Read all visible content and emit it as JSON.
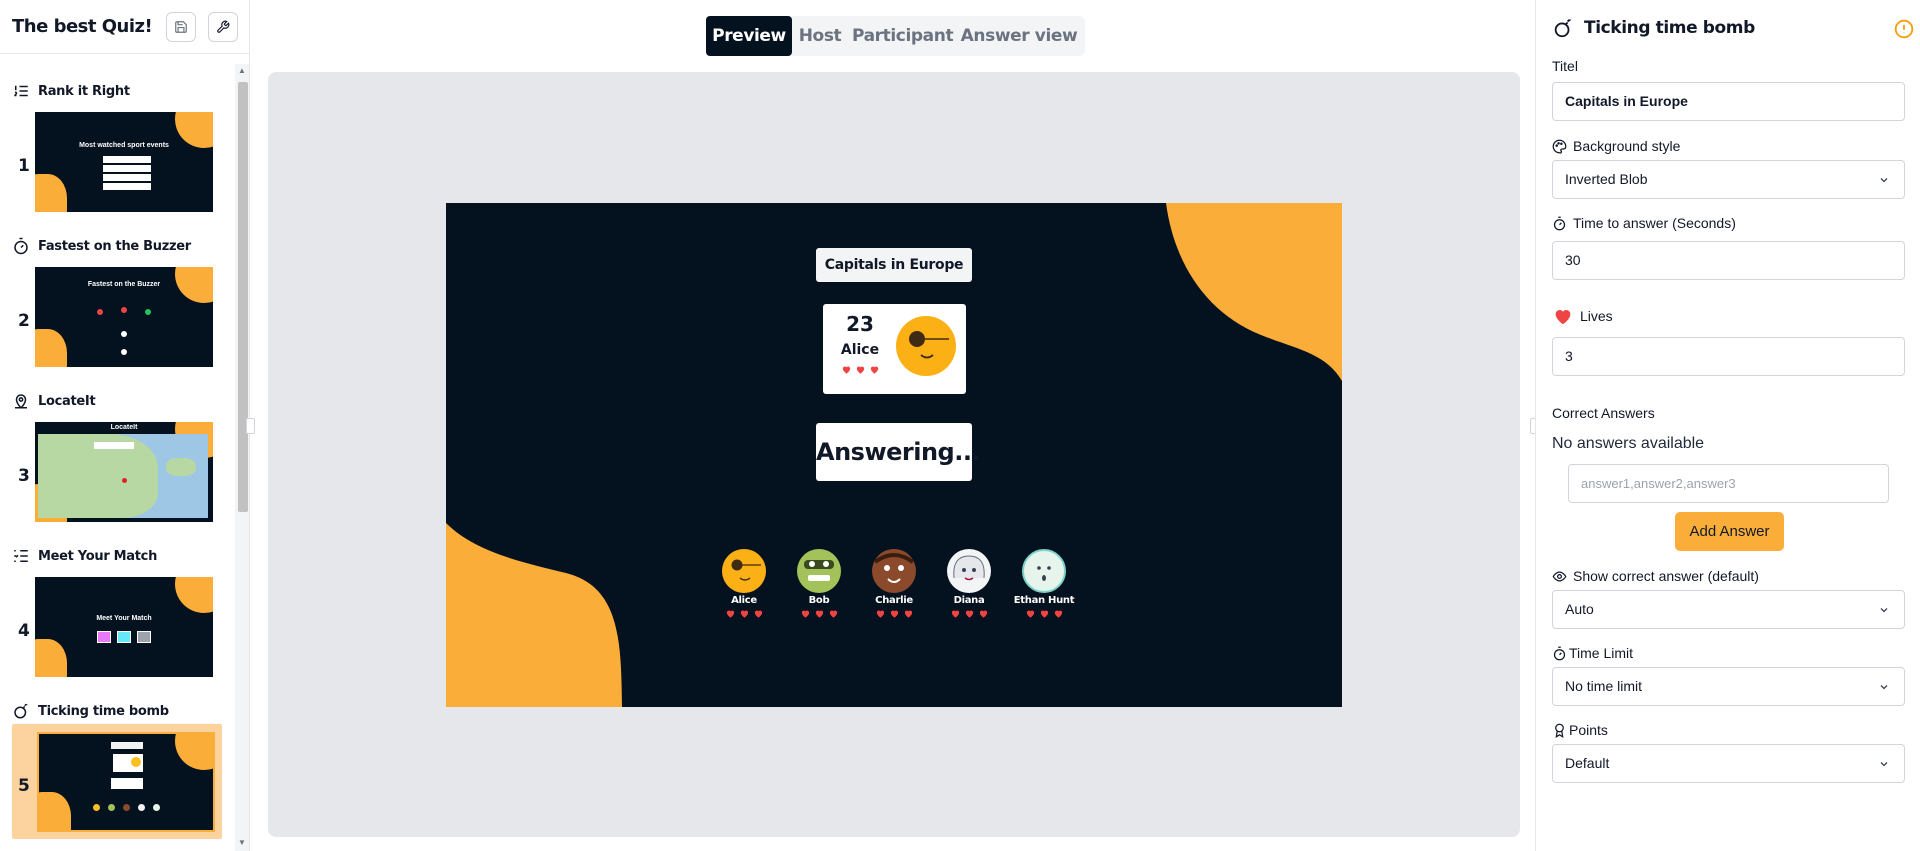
{
  "sidebar": {
    "quiz_title": "The best Quiz!",
    "slides": [
      {
        "number": "1",
        "type_label": "Rank it Right",
        "icon": "list-ordered-icon",
        "thumb_title": "Most watched sport events"
      },
      {
        "number": "2",
        "type_label": "Fastest on the Buzzer",
        "icon": "timer-icon",
        "thumb_title": "Fastest on the Buzzer"
      },
      {
        "number": "3",
        "type_label": "LocateIt",
        "icon": "map-pin-icon",
        "thumb_title": "LocateIt"
      },
      {
        "number": "4",
        "type_label": "Meet Your Match",
        "icon": "list-checks-icon",
        "thumb_title": "Meet Your Match"
      },
      {
        "number": "5",
        "type_label": "Ticking time bomb",
        "icon": "bomb-icon",
        "thumb_title": "",
        "active": true
      }
    ]
  },
  "view_tabs": [
    {
      "label": "Preview",
      "active": true
    },
    {
      "label": "Host"
    },
    {
      "label": "Participant"
    },
    {
      "label": "Answer view"
    }
  ],
  "preview": {
    "question_title": "Capitals in Europe",
    "current_player": {
      "score": "23",
      "name": "Alice",
      "lives": 3
    },
    "status_text": "Answering...",
    "players": [
      {
        "name": "Alice",
        "lives": 3
      },
      {
        "name": "Bob",
        "lives": 3
      },
      {
        "name": "Charlie",
        "lives": 3
      },
      {
        "name": "Diana",
        "lives": 3
      },
      {
        "name": "Ethan Hunt",
        "lives": 3
      }
    ]
  },
  "panel": {
    "title": "Ticking time bomb",
    "title_label": "Titel",
    "title_value": "Capitals in Europe",
    "background_label": "Background style",
    "background_value": "Inverted Blob",
    "time_label": "Time to answer (Seconds)",
    "time_value": "30",
    "lives_label": "Lives",
    "lives_value": "3",
    "correct_answers_label": "Correct Answers",
    "no_answers_text": "No answers available",
    "answer_placeholder": "answer1,answer2,answer3",
    "add_answer_label": "Add Answer",
    "show_correct_label": "Show correct answer (default)",
    "show_correct_value": "Auto",
    "time_limit_label": "Time Limit",
    "time_limit_value": "No time limit",
    "points_label": "Points",
    "points_value": "Default"
  },
  "colors": {
    "accent_orange": "#fbad3a",
    "canvas_navy": "#04111e",
    "heart_red": "#ef4444"
  }
}
